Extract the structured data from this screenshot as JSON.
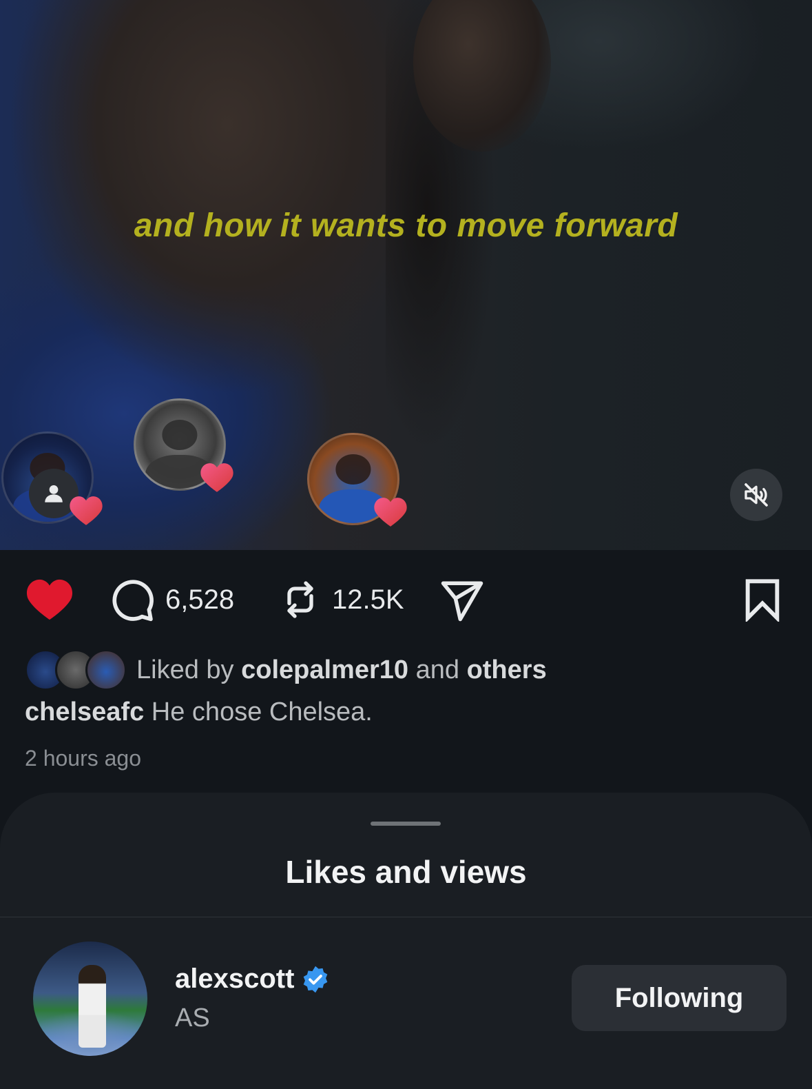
{
  "video": {
    "subtitle": "and how it wants to move forward",
    "mute_icon": "speaker-muted-icon"
  },
  "actions": {
    "like_icon": "heart-filled-icon",
    "like_color": "#e0192e",
    "comment_icon": "comment-bubble-icon",
    "comment_count": "6,528",
    "repost_icon": "repost-icon",
    "repost_count": "12.5K",
    "share_icon": "paper-plane-icon",
    "save_icon": "bookmark-icon"
  },
  "likes": {
    "prefix": "Liked by",
    "user": "colepalmer10",
    "connector": "and",
    "others": "others"
  },
  "caption": {
    "account": "chelseafc",
    "text": "He chose Chelsea."
  },
  "timestamp": "2 hours ago",
  "sheet": {
    "title": "Likes and views",
    "rows": [
      {
        "username": "alexscott",
        "verified": true,
        "full_name": "AS",
        "button_label": "Following"
      }
    ]
  },
  "colors": {
    "subtitle": "#b4b11f",
    "verified_badge": "#3897f0",
    "background": "#12161b"
  }
}
